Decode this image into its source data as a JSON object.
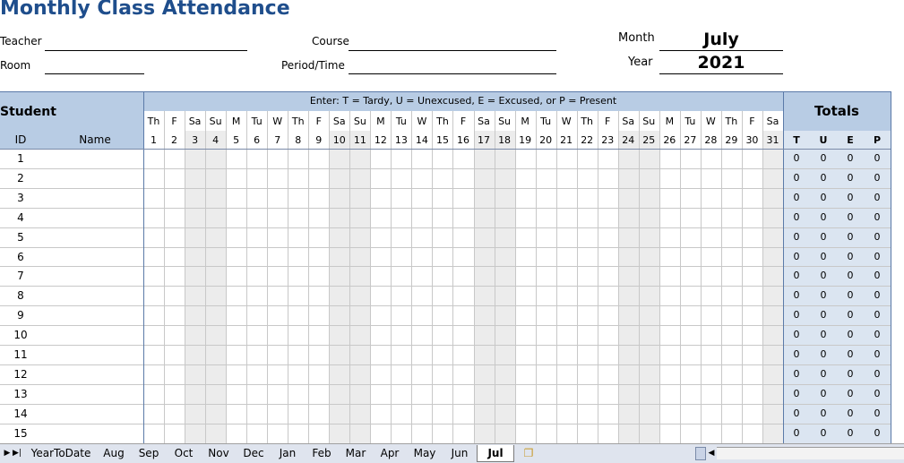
{
  "title": "Monthly Class Attendance",
  "form": {
    "teacher_label": "Teacher",
    "room_label": "Room",
    "course_label": "Course",
    "period_label": "Period/Time",
    "month_label": "Month",
    "month_value": "July",
    "year_label": "Year",
    "year_value": "2021"
  },
  "grid": {
    "student_label": "Student",
    "id_label": "ID",
    "name_label": "Name",
    "legend": "Enter: T = Tardy, U = Unexcused, E = Excused, or P = Present",
    "totals_label": "Totals",
    "totals_columns": [
      "T",
      "U",
      "E",
      "P"
    ],
    "day_names": [
      "Th",
      "F",
      "Sa",
      "Su",
      "M",
      "Tu",
      "W",
      "Th",
      "F",
      "Sa",
      "Su",
      "M",
      "Tu",
      "W",
      "Th",
      "F",
      "Sa",
      "Su",
      "M",
      "Tu",
      "W",
      "Th",
      "F",
      "Sa",
      "Su",
      "M",
      "Tu",
      "W",
      "Th",
      "F",
      "Sa"
    ],
    "day_numbers": [
      "1",
      "2",
      "3",
      "4",
      "5",
      "6",
      "7",
      "8",
      "9",
      "10",
      "11",
      "12",
      "13",
      "14",
      "15",
      "16",
      "17",
      "18",
      "19",
      "20",
      "21",
      "22",
      "23",
      "24",
      "25",
      "26",
      "27",
      "28",
      "29",
      "30",
      "31"
    ],
    "rows": [
      {
        "id": "1",
        "totals": [
          "0",
          "0",
          "0",
          "0"
        ]
      },
      {
        "id": "2",
        "totals": [
          "0",
          "0",
          "0",
          "0"
        ]
      },
      {
        "id": "3",
        "totals": [
          "0",
          "0",
          "0",
          "0"
        ]
      },
      {
        "id": "4",
        "totals": [
          "0",
          "0",
          "0",
          "0"
        ]
      },
      {
        "id": "5",
        "totals": [
          "0",
          "0",
          "0",
          "0"
        ]
      },
      {
        "id": "6",
        "totals": [
          "0",
          "0",
          "0",
          "0"
        ]
      },
      {
        "id": "7",
        "totals": [
          "0",
          "0",
          "0",
          "0"
        ]
      },
      {
        "id": "8",
        "totals": [
          "0",
          "0",
          "0",
          "0"
        ]
      },
      {
        "id": "9",
        "totals": [
          "0",
          "0",
          "0",
          "0"
        ]
      },
      {
        "id": "10",
        "totals": [
          "0",
          "0",
          "0",
          "0"
        ]
      },
      {
        "id": "11",
        "totals": [
          "0",
          "0",
          "0",
          "0"
        ]
      },
      {
        "id": "12",
        "totals": [
          "0",
          "0",
          "0",
          "0"
        ]
      },
      {
        "id": "13",
        "totals": [
          "0",
          "0",
          "0",
          "0"
        ]
      },
      {
        "id": "14",
        "totals": [
          "0",
          "0",
          "0",
          "0"
        ]
      },
      {
        "id": "15",
        "totals": [
          "0",
          "0",
          "0",
          "0"
        ]
      }
    ]
  },
  "sheet_tabs": {
    "items": [
      "YearToDate",
      "Aug",
      "Sep",
      "Oct",
      "Nov",
      "Dec",
      "Jan",
      "Feb",
      "Mar",
      "Apr",
      "May",
      "Jun",
      "Jul"
    ],
    "active": "Jul",
    "nav_icons": [
      "next-sheet-icon",
      "last-sheet-icon"
    ],
    "new_sheet_icon": "insert-sheet-icon"
  }
}
